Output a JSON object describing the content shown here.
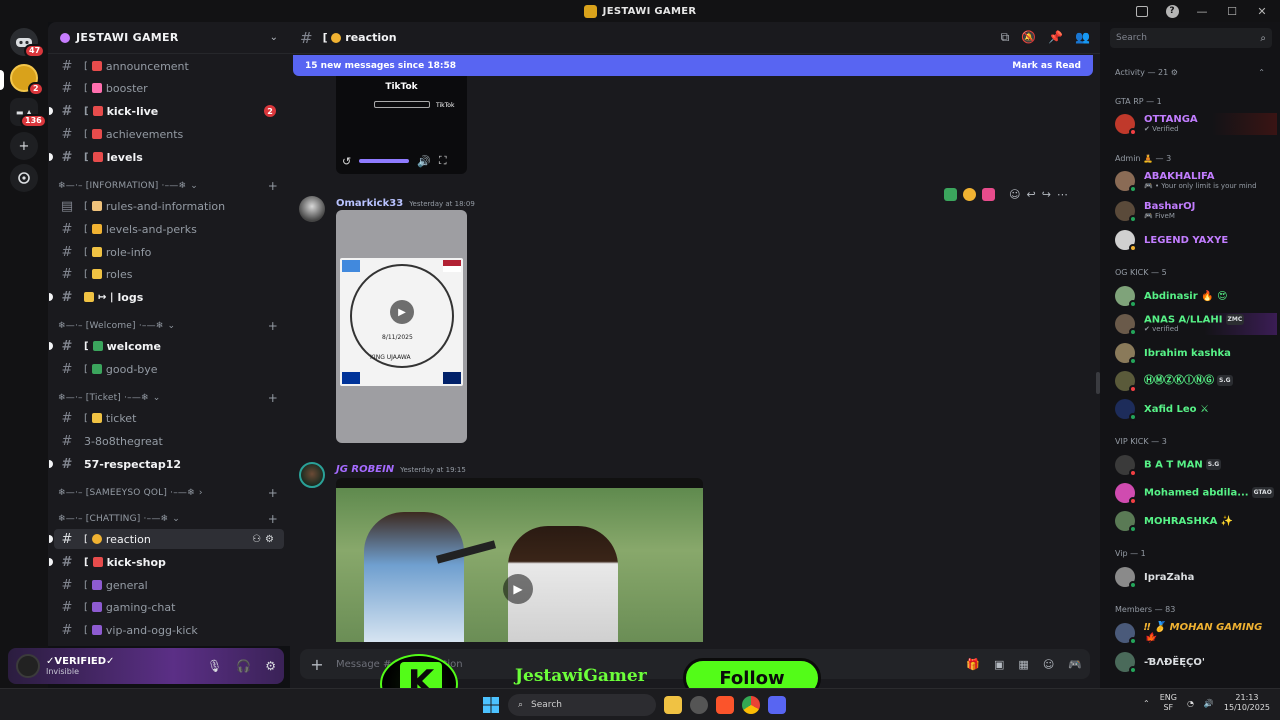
{
  "window": {
    "title": "JESTAWI GAMER"
  },
  "rail": {
    "dm_badge": "47",
    "server_badge": "2",
    "folder_badge": "136"
  },
  "guild": {
    "name": "JESTAWI GAMER"
  },
  "channels": [
    {
      "name": "announcement",
      "bracket": "[",
      "unread": false
    },
    {
      "name": "booster",
      "bracket": "[",
      "unread": false
    },
    {
      "name": "kick-live",
      "bracket": "[",
      "unread": true,
      "mentions": "2"
    },
    {
      "name": "achievements",
      "bracket": "[",
      "unread": false
    },
    {
      "name": "levels",
      "bracket": "[",
      "unread": true
    }
  ],
  "categories": {
    "information": "❄—·– [INFORMATION] ·–—❄",
    "welcome": "❄—·– [Welcome] ·–—❄",
    "ticket": "❄—·– [Ticket] ·–—❄",
    "sameeyso": "❄—·– [SAMEEYSO QOL] ·–—❄",
    "chatting": "❄—·– [CHATTING] ·–—❄"
  },
  "info_channels": [
    {
      "name": "rules-and-information",
      "bracket": "["
    },
    {
      "name": "levels-and-perks",
      "bracket": "["
    },
    {
      "name": "role-info",
      "bracket": "["
    },
    {
      "name": "roles",
      "bracket": "["
    },
    {
      "name": "logs",
      "bracket": "↦ |"
    }
  ],
  "welcome_channels": [
    {
      "name": "welcome",
      "bracket": "["
    },
    {
      "name": "good-bye",
      "bracket": "["
    }
  ],
  "ticket_channels": [
    {
      "name": "ticket",
      "bracket": "["
    },
    {
      "name": "3-8o8thegreat",
      "bracket": ""
    },
    {
      "name": "57-respectap12",
      "bracket": ""
    }
  ],
  "chatting_channels": [
    {
      "name": "reaction",
      "bracket": "["
    },
    {
      "name": "kick-shop",
      "bracket": "["
    },
    {
      "name": "general",
      "bracket": "["
    },
    {
      "name": "gaming-chat",
      "bracket": "["
    },
    {
      "name": "vip-and-ogg-kick",
      "bracket": "["
    }
  ],
  "user": {
    "name": "✓VERIFIED✓",
    "status": "Invisible"
  },
  "chat": {
    "channel_name": "reaction",
    "channel_prefix": "[",
    "new_messages": "15 new messages since 18:58",
    "mark_read": "Mark as Read",
    "tiktok_label": "TikTok",
    "tiktok_label2": "TikTok",
    "messages": [
      {
        "author": "Omarkick33",
        "time": "Yesterday at 18:09",
        "color": "#b9c3ff"
      },
      {
        "author": "JG ROBEIN",
        "time": "Yesterday at 19:15",
        "color": "#a56bff"
      }
    ],
    "poster": {
      "line1": "KING UJAAWA",
      "date": "8/11/2025"
    },
    "composer_placeholder": "Message # [ 😊 | reaction"
  },
  "members": {
    "search_placeholder": "Search",
    "activity": "Activity — 21 ⚙",
    "groups": [
      {
        "label": "GTA RP — 1"
      },
      {
        "label": "Admin 🧘 — 3"
      },
      {
        "label": "OG KICK — 5"
      },
      {
        "label": "VIP KICK — 3"
      },
      {
        "label": "Vip — 1"
      },
      {
        "label": "Members — 83"
      }
    ],
    "list": [
      {
        "name": "OTTANGA",
        "sub": "✔ Verified",
        "color": "#c27dff"
      },
      {
        "name": "ABAKHALIFA",
        "sub": "🎮 • Your only limit is your mind",
        "color": "#c27dff"
      },
      {
        "name": "BasharOJ",
        "sub": "🎮 FiveM",
        "color": "#c27dff"
      },
      {
        "name": "LEGEND YAXYE",
        "sub": "",
        "color": "#c27dff"
      },
      {
        "name": "Abdinasir 🔥 😍",
        "sub": "",
        "color": "#57f287"
      },
      {
        "name": "ANAS A/LLAHI",
        "sub": "✔ verified",
        "color": "#57f287",
        "tag": "ZMC"
      },
      {
        "name": "Ibrahim kashka",
        "sub": "",
        "color": "#57f287"
      },
      {
        "name": "ⒽⓂⓏⓀⒾⓃⒼ",
        "sub": "",
        "color": "#57f287",
        "tag": "S.G"
      },
      {
        "name": "Xafid Leo ⚔",
        "sub": "",
        "color": "#57f287"
      },
      {
        "name": "B A T MAN",
        "sub": "",
        "color": "#57f287",
        "tag": "S.G"
      },
      {
        "name": "Mohamed abdila...",
        "sub": "",
        "color": "#57f287",
        "tag": "GTAO"
      },
      {
        "name": "MOHRASHKA ✨",
        "sub": "",
        "color": "#57f287"
      },
      {
        "name": "IpraZaha",
        "sub": "",
        "color": "#dbdee1"
      },
      {
        "name": "‼ 🥇 MOHAN GAMING 🍁",
        "sub": "",
        "color": "#f0b232"
      },
      {
        "name": "-ƁΛĐËĘÇO'",
        "sub": "",
        "color": "#dbdee1"
      }
    ]
  },
  "overlay": {
    "streamer": "JestawiGamer",
    "follow": "Follow"
  },
  "taskbar": {
    "search": "Search",
    "lang1": "ENG",
    "lang2": "SF",
    "time": "21:13",
    "date": "15/10/2025"
  }
}
